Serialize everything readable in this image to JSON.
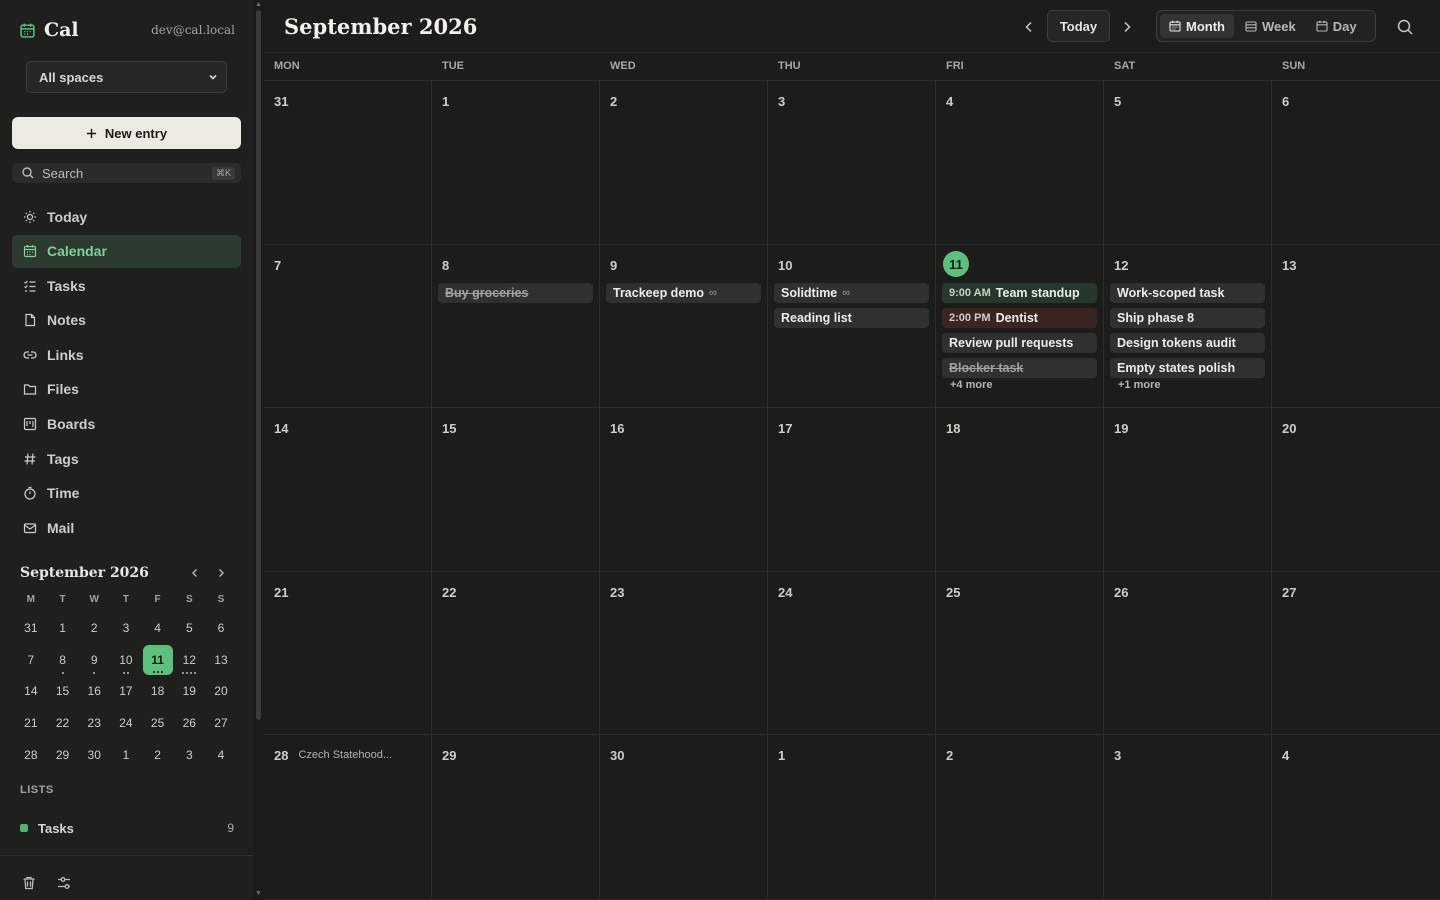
{
  "sidebar": {
    "brand": "Cal",
    "account": "dev@cal.local",
    "space_select": "All spaces",
    "new_entry": "New entry",
    "search_placeholder": "Search",
    "search_kbd": "⌘K",
    "nav": [
      {
        "label": "Today",
        "icon": "sun-icon"
      },
      {
        "label": "Calendar",
        "icon": "calendar-icon",
        "active": true
      },
      {
        "label": "Tasks",
        "icon": "tasks-icon"
      },
      {
        "label": "Notes",
        "icon": "note-icon"
      },
      {
        "label": "Links",
        "icon": "link-icon"
      },
      {
        "label": "Files",
        "icon": "folder-icon"
      },
      {
        "label": "Boards",
        "icon": "board-icon"
      },
      {
        "label": "Tags",
        "icon": "hash-icon"
      },
      {
        "label": "Time",
        "icon": "timer-icon"
      },
      {
        "label": "Mail",
        "icon": "mail-icon"
      }
    ],
    "mini_calendar": {
      "title": "September 2026",
      "weekdays": [
        "M",
        "T",
        "W",
        "T",
        "F",
        "S",
        "S"
      ],
      "days": [
        [
          31,
          1,
          2,
          3,
          4,
          5,
          6
        ],
        [
          7,
          8,
          9,
          10,
          11,
          12,
          13
        ],
        [
          14,
          15,
          16,
          17,
          18,
          19,
          20
        ],
        [
          21,
          22,
          23,
          24,
          25,
          26,
          27
        ],
        [
          28,
          29,
          30,
          1,
          2,
          3,
          4
        ]
      ],
      "today": 11,
      "dots": {
        "8": 1,
        "9": 1,
        "10": 2,
        "11": 3,
        "12": 4
      }
    },
    "lists_title": "LISTS",
    "lists": [
      {
        "label": "Tasks",
        "count": "9",
        "color": "#4fb570"
      }
    ]
  },
  "toolbar": {
    "title": "September 2026",
    "today": "Today",
    "views": [
      {
        "label": "Month",
        "active": true
      },
      {
        "label": "Week"
      },
      {
        "label": "Day"
      }
    ]
  },
  "weekdays": [
    "MON",
    "TUE",
    "WED",
    "THU",
    "FRI",
    "SAT",
    "SUN"
  ],
  "weeks": [
    [
      {
        "d": "31"
      },
      {
        "d": "1"
      },
      {
        "d": "2"
      },
      {
        "d": "3"
      },
      {
        "d": "4"
      },
      {
        "d": "5"
      },
      {
        "d": "6"
      }
    ],
    [
      {
        "d": "7"
      },
      {
        "d": "8",
        "events": [
          {
            "title": "Buy groceries",
            "done": true
          }
        ]
      },
      {
        "d": "9",
        "events": [
          {
            "title": "Trackeep demo",
            "loop": "∞"
          }
        ]
      },
      {
        "d": "10",
        "events": [
          {
            "title": "Solidtime",
            "loop": "∞"
          },
          {
            "title": "Reading list"
          }
        ]
      },
      {
        "d": "11",
        "today": true,
        "events": [
          {
            "time": "9:00 AM",
            "title": "Team standup",
            "color": "green"
          },
          {
            "time": "2:00 PM",
            "title": "Dentist",
            "color": "red"
          },
          {
            "title": "Review pull requests"
          },
          {
            "title": "Blocker task",
            "done": true
          }
        ],
        "more": "+4 more"
      },
      {
        "d": "12",
        "events": [
          {
            "title": "Work-scoped task"
          },
          {
            "title": "Ship phase 8"
          },
          {
            "title": "Design tokens audit"
          },
          {
            "title": "Empty states polish"
          }
        ],
        "more": "+1 more"
      },
      {
        "d": "13"
      }
    ],
    [
      {
        "d": "14"
      },
      {
        "d": "15"
      },
      {
        "d": "16"
      },
      {
        "d": "17"
      },
      {
        "d": "18"
      },
      {
        "d": "19"
      },
      {
        "d": "20"
      }
    ],
    [
      {
        "d": "21"
      },
      {
        "d": "22"
      },
      {
        "d": "23"
      },
      {
        "d": "24"
      },
      {
        "d": "25"
      },
      {
        "d": "26"
      },
      {
        "d": "27"
      }
    ],
    [
      {
        "d": "28",
        "holiday": "Czech Statehood..."
      },
      {
        "d": "29"
      },
      {
        "d": "30"
      },
      {
        "d": "1"
      },
      {
        "d": "2"
      },
      {
        "d": "3"
      },
      {
        "d": "4"
      }
    ]
  ]
}
